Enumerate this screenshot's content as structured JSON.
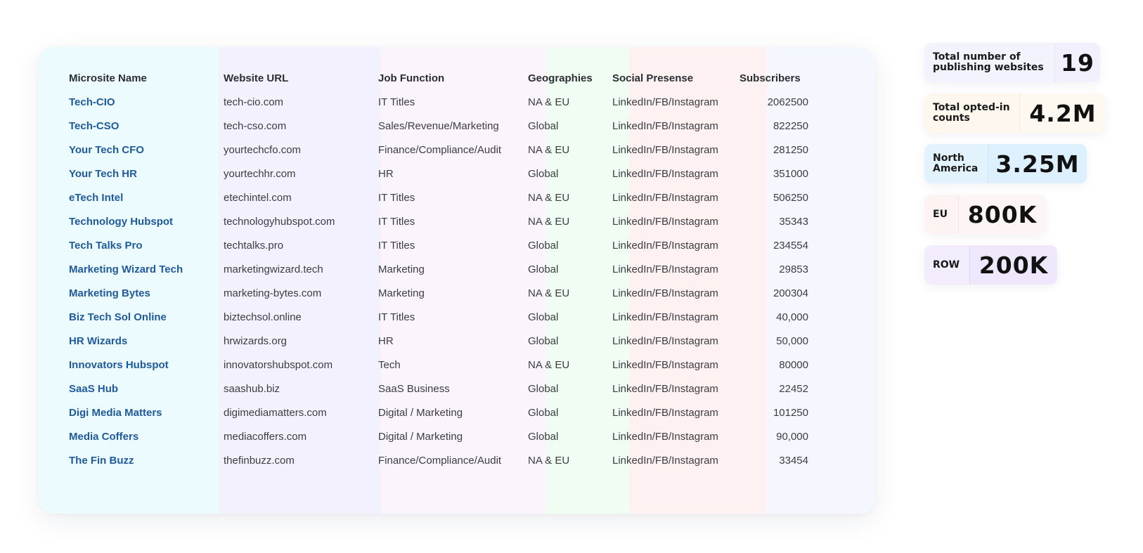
{
  "table": {
    "headers": [
      "Microsite Name",
      "Website URL",
      "Job Function",
      "Geographies",
      "Social Presense",
      "Subscribers"
    ],
    "rows": [
      [
        "Tech-CIO",
        "tech-cio.com",
        "IT Titles",
        "NA & EU",
        "LinkedIn/FB/Instagram",
        "2062500"
      ],
      [
        "Tech-CSO",
        "tech-cso.com",
        "Sales/Revenue/Marketing",
        "Global",
        "LinkedIn/FB/Instagram",
        "822250"
      ],
      [
        "Your Tech CFO",
        "yourtechcfo.com",
        "Finance/Compliance/Audit",
        "NA & EU",
        "LinkedIn/FB/Instagram",
        "281250"
      ],
      [
        "Your Tech HR",
        "yourtechhr.com",
        "HR",
        "Global",
        "LinkedIn/FB/Instagram",
        "351000"
      ],
      [
        "eTech Intel",
        "etechintel.com",
        "IT Titles",
        "NA & EU",
        "LinkedIn/FB/Instagram",
        "506250"
      ],
      [
        "Technology Hubspot",
        "technologyhubspot.com",
        "IT Titles",
        "NA & EU",
        "LinkedIn/FB/Instagram",
        "35343"
      ],
      [
        "Tech Talks Pro",
        "techtalks.pro",
        "IT Titles",
        "Global",
        "LinkedIn/FB/Instagram",
        "234554"
      ],
      [
        "Marketing Wizard Tech",
        "marketingwizard.tech",
        "Marketing",
        "Global",
        "LinkedIn/FB/Instagram",
        "29853"
      ],
      [
        "Marketing Bytes",
        "marketing-bytes.com",
        "Marketing",
        "NA & EU",
        "LinkedIn/FB/Instagram",
        "200304"
      ],
      [
        "Biz Tech Sol Online",
        "biztechsol.online",
        "IT Titles",
        "Global",
        "LinkedIn/FB/Instagram",
        "40,000"
      ],
      [
        "HR Wizards",
        "hrwizards.org",
        "HR",
        "Global",
        "LinkedIn/FB/Instagram",
        "50,000"
      ],
      [
        "Innovators Hubspot",
        "innovatorshubspot.com",
        "Tech",
        "NA & EU",
        "LinkedIn/FB/Instagram",
        "80000"
      ],
      [
        "SaaS Hub",
        "saashub.biz",
        "SaaS Business",
        "Global",
        "LinkedIn/FB/Instagram",
        "22452"
      ],
      [
        "Digi Media Matters",
        "digimediamatters.com",
        "Digital / Marketing",
        "Global",
        "LinkedIn/FB/Instagram",
        "101250"
      ],
      [
        "Media Coffers",
        "mediacoffers.com",
        "Digital / Marketing",
        "Global",
        "LinkedIn/FB/Instagram",
        "90,000"
      ],
      [
        "The Fin Buzz",
        "thefinbuzz.com",
        "Finance/Compliance/Audit",
        "NA & EU",
        "LinkedIn/FB/Instagram",
        "33454"
      ]
    ]
  },
  "stats": [
    {
      "label_lines": [
        "Total number of",
        "publishing websites"
      ],
      "value": "19",
      "label_bg": "#f3f3fd",
      "value_bg": "#f1f0fc"
    },
    {
      "label_lines": [
        "Total opted-in",
        "counts"
      ],
      "value": "4.2M",
      "label_bg": "#fdf7ee",
      "value_bg": "#fef9f0"
    },
    {
      "label_lines": [
        "North",
        "America"
      ],
      "value": "3.25M",
      "label_bg": "#e3f3fd",
      "value_bg": "#dcf0fd"
    },
    {
      "label_lines": [
        "EU"
      ],
      "value": "800K",
      "label_bg": "#fdf3f3",
      "value_bg": "#fdf5f5"
    },
    {
      "label_lines": [
        "ROW"
      ],
      "value": "200K",
      "label_bg": "#f2ecfd",
      "value_bg": "#efe8fd"
    }
  ],
  "colors": {
    "name_link": "#1f5a9c",
    "text": "#3a3d42"
  }
}
